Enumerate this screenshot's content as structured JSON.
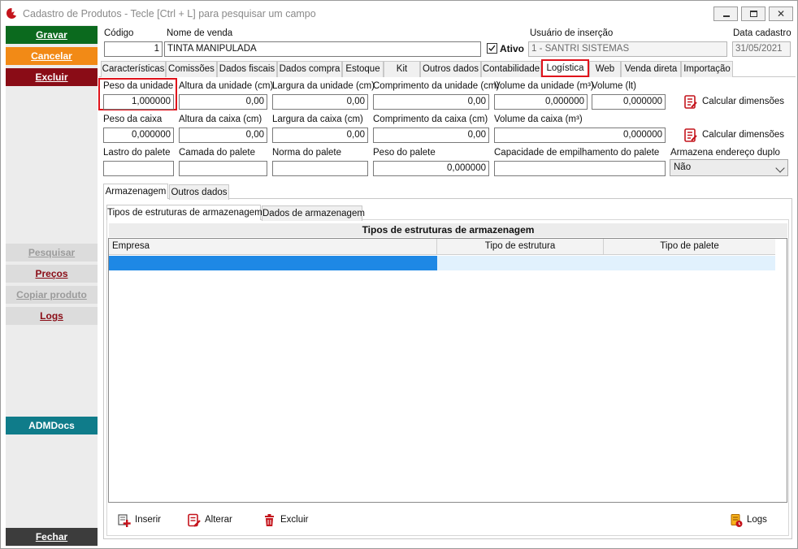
{
  "window": {
    "title": "Cadastro de Produtos - Tecle [Ctrl + L] para pesquisar um campo"
  },
  "sidebar": {
    "gravar": "Gravar",
    "cancelar": "Cancelar",
    "excluir": "Excluir",
    "pesquisar": "Pesquisar",
    "precos": "Preços",
    "copiar": "Copiar produto",
    "logs": "Logs",
    "admdocs": "ADMDocs",
    "fechar": "Fechar"
  },
  "header": {
    "codigo_label": "Código",
    "codigo_value": "1",
    "nome_label": "Nome de venda",
    "nome_value": "TINTA MANIPULADA",
    "ativo_label": "Ativo",
    "ativo_checked": true,
    "usuario_label": "Usuário de inserção",
    "usuario_value": "1 - SANTRI SISTEMAS",
    "data_label": "Data cadastro",
    "data_value": "31/05/2021"
  },
  "tabs": [
    {
      "label": "Características"
    },
    {
      "label": "Comissões"
    },
    {
      "label": "Dados fiscais"
    },
    {
      "label": "Dados compra"
    },
    {
      "label": "Estoque"
    },
    {
      "label": "Kit"
    },
    {
      "label": "Outros dados"
    },
    {
      "label": "Contabilidade"
    },
    {
      "label": "Logística",
      "active": true
    },
    {
      "label": "Web"
    },
    {
      "label": "Venda direta"
    },
    {
      "label": "Importação"
    }
  ],
  "logistica": {
    "peso_unidade_label": "Peso da unidade",
    "peso_unidade_value": "1,000000",
    "altura_unidade_label": "Altura da unidade (cm)",
    "altura_unidade_value": "0,00",
    "largura_unidade_label": "Largura da unidade (cm)",
    "largura_unidade_value": "0,00",
    "comprimento_unidade_label": "Comprimento da unidade (cm)",
    "comprimento_unidade_value": "0,00",
    "volume_unidade_label": "Volume da unidade (m³)",
    "volume_unidade_value": "0,000000",
    "volume_lt_label": "Volume (lt)",
    "volume_lt_value": "0,000000",
    "calcular_label": "Calcular dimensões",
    "peso_caixa_label": "Peso da caixa",
    "peso_caixa_value": "0,000000",
    "altura_caixa_label": "Altura da caixa (cm)",
    "altura_caixa_value": "0,00",
    "largura_caixa_label": "Largura da caixa (cm)",
    "largura_caixa_value": "0,00",
    "comprimento_caixa_label": "Comprimento da caixa (cm)",
    "comprimento_caixa_value": "0,00",
    "volume_caixa_label": "Volume da caixa (m³)",
    "volume_caixa_value": "0,000000",
    "lastro_label": "Lastro do palete",
    "lastro_value": "",
    "camada_label": "Camada do palete",
    "camada_value": "",
    "norma_label": "Norma do palete",
    "norma_value": "",
    "peso_palete_label": "Peso do palete",
    "peso_palete_value": "0,000000",
    "capacidade_label": "Capacidade de empilhamento do palete",
    "capacidade_value": "",
    "endereco_duplo_label": "Armazena endereço duplo",
    "endereco_duplo_value": "Não"
  },
  "subtabs": {
    "armazenagem": "Armazenagem",
    "outros_dados": "Outros dados"
  },
  "subsubtabs": {
    "tipos": "Tipos de estruturas de armazenagem",
    "dados": "Dados de armazenagem"
  },
  "grid": {
    "title": "Tipos de estruturas de armazenagem",
    "columns": [
      "Empresa",
      "Tipo de estrutura",
      "Tipo de palete"
    ],
    "rows": [
      [
        "",
        "",
        ""
      ]
    ]
  },
  "actions": {
    "inserir": "Inserir",
    "alterar": "Alterar",
    "excluir": "Excluir",
    "logs": "Logs"
  },
  "colors": {
    "gravar": "#0b6a1e",
    "cancelar": "#f28a16",
    "excluir": "#8a0c16",
    "admdocs": "#0f7c8a",
    "fechar": "#3c3c3c",
    "highlight": "#e0121b",
    "selected_row": "#1e88e5"
  }
}
